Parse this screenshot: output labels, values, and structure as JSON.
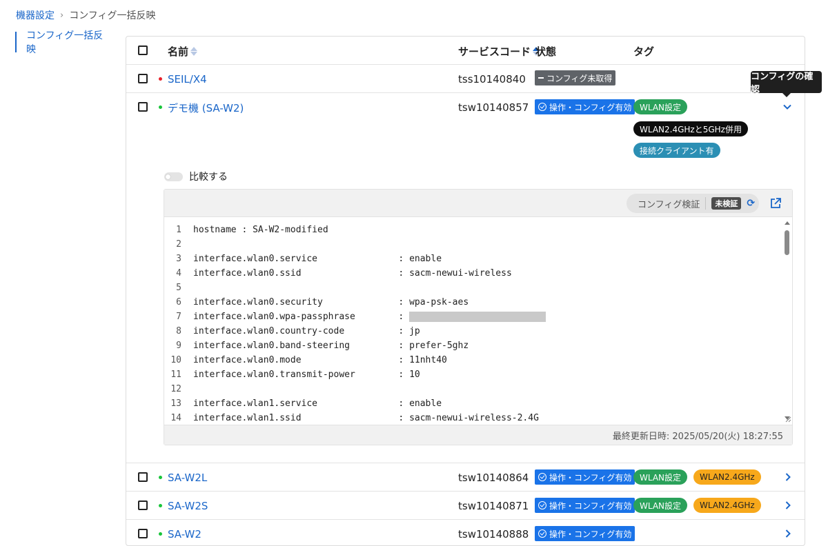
{
  "breadcrumb": {
    "parent": "機器設定",
    "separator": "›",
    "current": "コンフィグ一括反映"
  },
  "sidebar": {
    "active_item": "コンフィグ一括反映"
  },
  "table": {
    "headers": {
      "name": "名前",
      "service_code": "サービスコード",
      "status": "状態",
      "tags": "タグ"
    },
    "rows": [
      {
        "name": "SEIL/X4",
        "status_dot": "red",
        "service_code": "tss10140840",
        "status": "コンフィグ未取得",
        "status_type": "gray",
        "tags": []
      },
      {
        "name": "デモ機 (SA-W2)",
        "status_dot": "green",
        "service_code": "tsw10140857",
        "status": "操作・コンフィグ有効",
        "status_type": "blue",
        "tags": [
          {
            "label": "WLAN設定",
            "color": "green"
          },
          {
            "label": "WLAN2.4GHzと5GHz併用",
            "color": "black"
          },
          {
            "label": "接続クライアント有",
            "color": "teal"
          }
        ]
      },
      {
        "name": "SA-W2L",
        "status_dot": "green",
        "service_code": "tsw10140864",
        "status": "操作・コンフィグ有効",
        "status_type": "blue",
        "tags": [
          {
            "label": "WLAN設定",
            "color": "green"
          },
          {
            "label": "WLAN2.4GHz",
            "color": "orange"
          }
        ]
      },
      {
        "name": "SA-W2S",
        "status_dot": "green",
        "service_code": "tsw10140871",
        "status": "操作・コンフィグ有効",
        "status_type": "blue",
        "tags": [
          {
            "label": "WLAN設定",
            "color": "green"
          },
          {
            "label": "WLAN2.4GHz",
            "color": "orange"
          }
        ]
      },
      {
        "name": "SA-W2",
        "status_dot": "green",
        "service_code": "tsw10140888",
        "status": "操作・コンフィグ有効",
        "status_type": "blue",
        "tags": []
      }
    ]
  },
  "tooltip": "コンフィグの確認",
  "compare_label": "比較する",
  "editor": {
    "verify_label": "コンフィグ検証",
    "verify_status": "未検証",
    "last_updated": "最終更新日時:  2025/05/20(火) 18:27:55",
    "lines": [
      {
        "n": "1",
        "text": "hostname : SA-W2-modified"
      },
      {
        "n": "2",
        "text": ""
      },
      {
        "n": "3",
        "text": "interface.wlan0.service               : enable"
      },
      {
        "n": "4",
        "text": "interface.wlan0.ssid                  : sacm-newui-wireless"
      },
      {
        "n": "5",
        "text": ""
      },
      {
        "n": "6",
        "text": "interface.wlan0.security              : wpa-psk-aes"
      },
      {
        "n": "7",
        "text": "interface.wlan0.wpa-passphrase        : "
      },
      {
        "n": "8",
        "text": "interface.wlan0.country-code          : jp"
      },
      {
        "n": "9",
        "text": "interface.wlan0.band-steering         : prefer-5ghz"
      },
      {
        "n": "10",
        "text": "interface.wlan0.mode                  : 11nht40"
      },
      {
        "n": "11",
        "text": "interface.wlan0.transmit-power        : 10"
      },
      {
        "n": "12",
        "text": ""
      },
      {
        "n": "13",
        "text": "interface.wlan1.service               : enable"
      },
      {
        "n": "14",
        "text": "interface.wlan1.ssid                  : sacm-newui-wireless-2.4G"
      }
    ]
  },
  "colors": {
    "accent": "#1a66c9",
    "status_blue": "#1a73e8",
    "tag_green": "#2aa15a",
    "tag_orange": "#f7a81b",
    "tag_teal": "#2b8fb4"
  }
}
